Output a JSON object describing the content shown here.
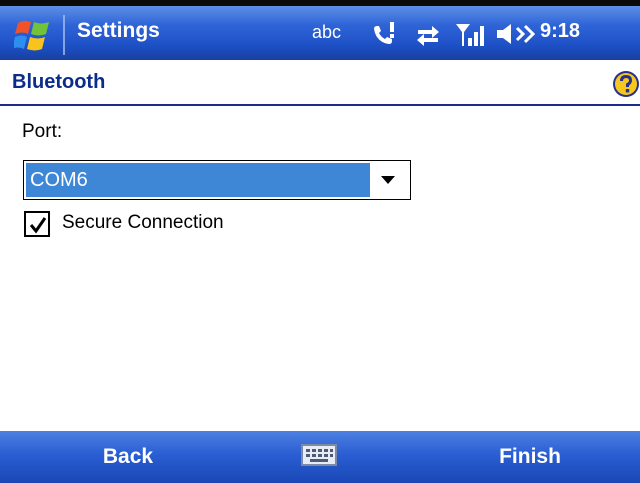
{
  "titlebar": {
    "app_title": "Settings",
    "input_mode": "abc",
    "clock": "9:18",
    "icons": [
      "windows-start-icon",
      "phone-missed-icon",
      "connectivity-icon",
      "signal-strength-icon",
      "volume-icon"
    ]
  },
  "header": {
    "title": "Bluetooth",
    "help_icon": "help-icon"
  },
  "form": {
    "port_label": "Port:",
    "port_value": "COM6",
    "secure_label": "Secure Connection",
    "secure_checked": true
  },
  "softkeys": {
    "left": "Back",
    "center_icon": "keyboard-icon",
    "right": "Finish"
  },
  "colors": {
    "bar_blue": "#2f64d8",
    "header_text": "#0b2c8c",
    "selection": "#3e86d6"
  }
}
